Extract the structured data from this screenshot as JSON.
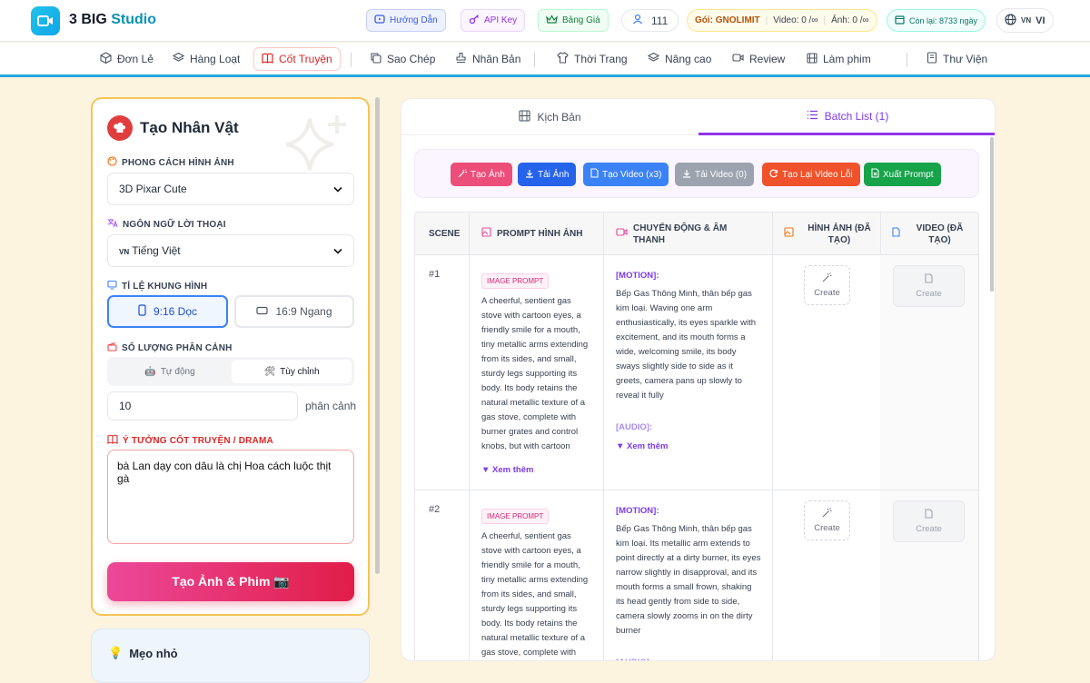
{
  "app": {
    "brand_main": "3 BIG",
    "brand_accent": "Studio"
  },
  "header": {
    "guide": "Hướng Dẫn",
    "api_key": "API Key",
    "pricing": "Bảng Giá",
    "user_count": "111",
    "plan": "Gói: GNOLIMIT",
    "video_quota": "Video: 0 /∞",
    "image_quota": "Ảnh: 0 /∞",
    "remaining": "Còn lại: 8733 ngày",
    "lang_flag": "VN",
    "lang": "VI"
  },
  "nav": {
    "items": [
      {
        "label": "Đơn Lẻ",
        "icon": "cube-icon"
      },
      {
        "label": "Hàng Loạt",
        "icon": "layers-icon"
      },
      {
        "label": "Cốt Truyện",
        "icon": "book-icon",
        "active": true
      },
      {
        "label": "Sao Chép",
        "icon": "copy-icon"
      },
      {
        "label": "Nhân Bản",
        "icon": "stamp-icon"
      },
      {
        "label": "Thời Trang",
        "icon": "shirt-icon"
      },
      {
        "label": "Nâng cao",
        "icon": "layers-icon"
      },
      {
        "label": "Review",
        "icon": "video-icon"
      },
      {
        "label": "Làm phim",
        "icon": "film-icon"
      },
      {
        "label": "Thư Viện",
        "icon": "library-icon"
      }
    ]
  },
  "form": {
    "title": "Tạo Nhân Vật",
    "style_label": "PHONG CÁCH HÌNH ẢNH",
    "style_value": "3D Pixar Cute",
    "lang_label": "NGÔN NGỮ LỜI THOẠI",
    "lang_flag": "VN",
    "lang_value": "Tiếng Việt",
    "ratio_label": "TỈ LỆ KHUNG HÌNH",
    "ratio_portrait": "9:16 Dọc",
    "ratio_landscape": "16:9 Ngang",
    "scenes_label": "SỐ LƯỢNG PHÂN CẢNH",
    "auto": "Tự động",
    "custom": "Tùy chỉnh",
    "scene_count": "10",
    "scene_unit": "phân cảnh",
    "idea_label": "Ý TƯỞNG CỐT TRUYỆN / DRAMA",
    "idea_text": "bà Lan dạy con dâu là chị Hoa cách luộc thịt gà",
    "submit": "Tạo Ảnh & Phim 📷",
    "tip_title": "Mẹo nhỏ"
  },
  "tabs": {
    "script": "Kịch Bản",
    "batch": "Batch List (1)"
  },
  "actions": {
    "create_images": "Tạo Ảnh",
    "download_images": "Tải Ảnh",
    "create_video": "Tạo Video (x3)",
    "download_video": "Tải Video (0)",
    "retry_failed": "Tạo Lại Video Lỗi",
    "export_prompt": "Xuất Prompt"
  },
  "table": {
    "col_scene": "SCENE",
    "col_prompt": "PROMPT HÌNH ẢNH",
    "col_motion": "CHUYỂN ĐỘNG & ÂM THANH",
    "col_image": "HÌNH ẢNH (ĐÃ TẠO)",
    "col_video": "VIDEO (ĐÃ TẠO)",
    "prompt_tag": "IMAGE PROMPT",
    "motion_tag": "[MOTION]:",
    "audio_tag": "[AUDIO]:",
    "see_more": "▼ Xem thêm",
    "create": "Create",
    "rows": [
      {
        "scene": "#1",
        "prompt": "A cheerful, sentient gas stove with cartoon eyes, a friendly smile for a mouth, tiny metallic arms extending from its sides, and small, sturdy legs supporting its body. Its body retains the natural metallic texture of a gas stove, complete with burner grates and control knobs, but with cartoon",
        "motion": "Bếp Gas Thông Minh, thân bếp gas kim loại. Waving one arm enthusiastically, its eyes sparkle with excitement, and its mouth forms a wide, welcoming smile, its body sways slightly side to side as it greets, camera pans up slowly to reveal it fully"
      },
      {
        "scene": "#2",
        "prompt": "A cheerful, sentient gas stove with cartoon eyes, a friendly smile for a mouth, tiny metallic arms extending from its sides, and small, sturdy legs supporting its body. Its body retains the natural metallic texture of a gas stove, complete with",
        "motion": "Bếp Gas Thông Minh, thân bếp gas kim loại. Its metallic arm extends to point directly at a dirty burner, its eyes narrow slightly in disapproval, and its mouth forms a small frown, shaking its head gently from side to side, camera slowly zooms in on the dirty burner"
      }
    ]
  }
}
